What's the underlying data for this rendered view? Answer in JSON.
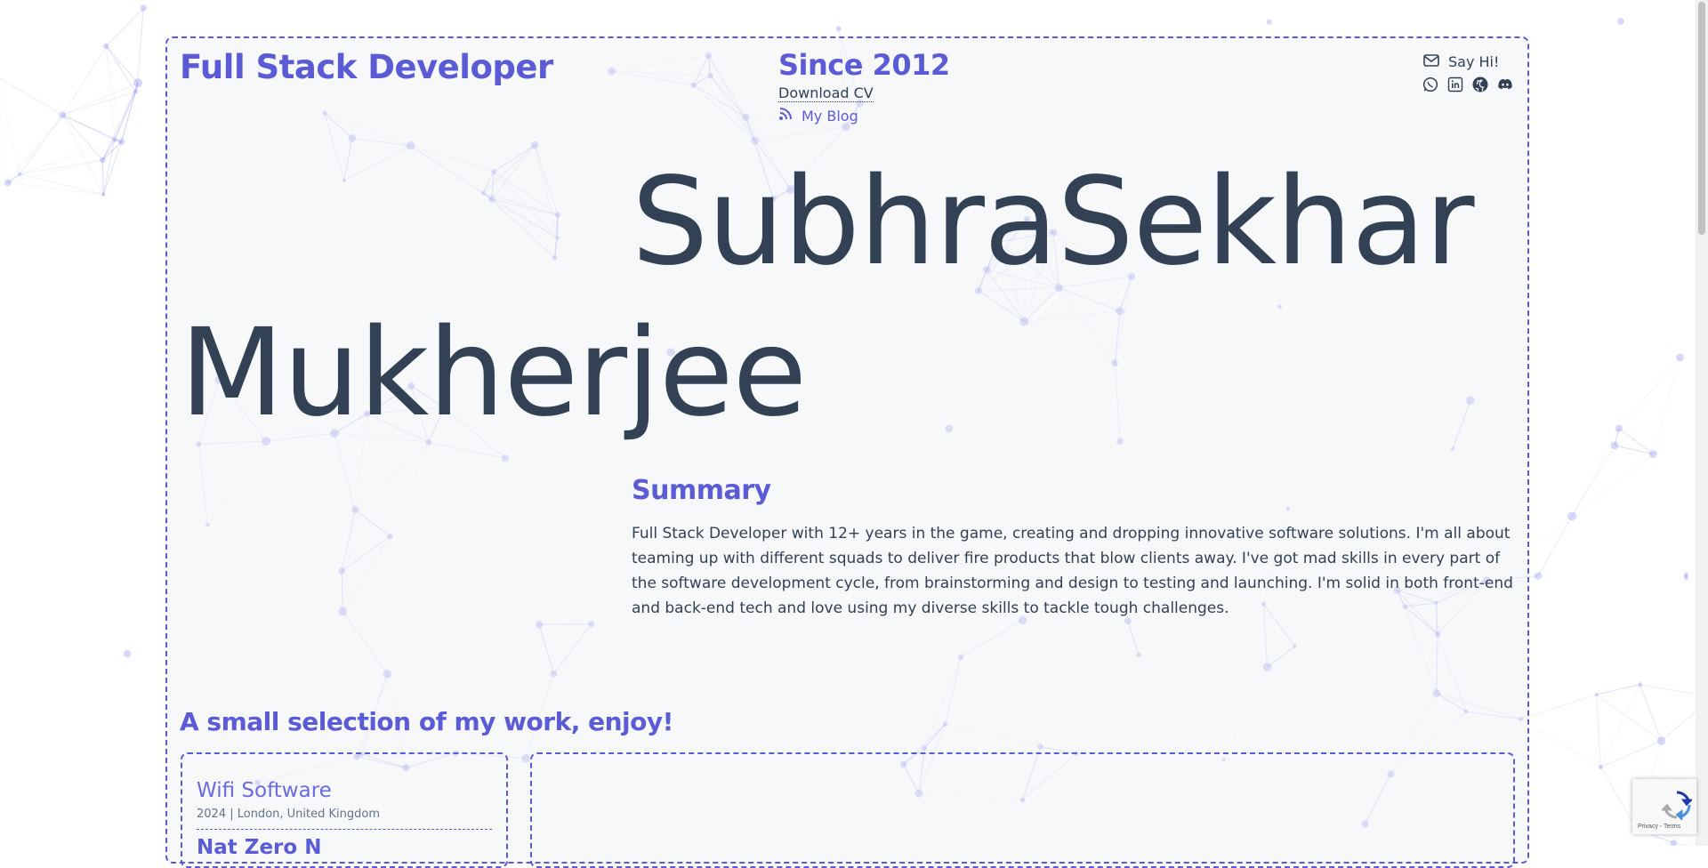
{
  "header": {
    "role_title": "Full Stack Developer",
    "since": "Since 2012",
    "download_cv": "Download CV",
    "blog_label": "My Blog",
    "say_hi": "Say Hi!"
  },
  "socials": [
    "whatsapp-icon",
    "linkedin-icon",
    "github-icon",
    "discord-icon"
  ],
  "hero": {
    "first_name": "SubhraSekhar",
    "last_name": "Mukherjee"
  },
  "summary": {
    "heading": "Summary",
    "text": "Full Stack Developer with 12+ years in the game, creating and dropping innovative software solutions. I'm all about teaming up with different squads to deliver fire products that blow clients away. I've got mad skills in every part of the software development cycle, from brainstorming and design to testing and launching. I'm solid in both front-end and back-end tech and love using my diverse skills to tackle tough challenges."
  },
  "work": {
    "heading": "A small selection of my work, enjoy!",
    "projects": [
      {
        "title": "Wifi Software",
        "meta": "2024 | London, United Kingdom"
      },
      {
        "title": "Nat Zero N"
      }
    ]
  },
  "recaptcha": {
    "links": "Privacy - Terms"
  },
  "colors": {
    "accent": "#5b5bd6",
    "text": "#334155",
    "muted": "#64748b"
  }
}
